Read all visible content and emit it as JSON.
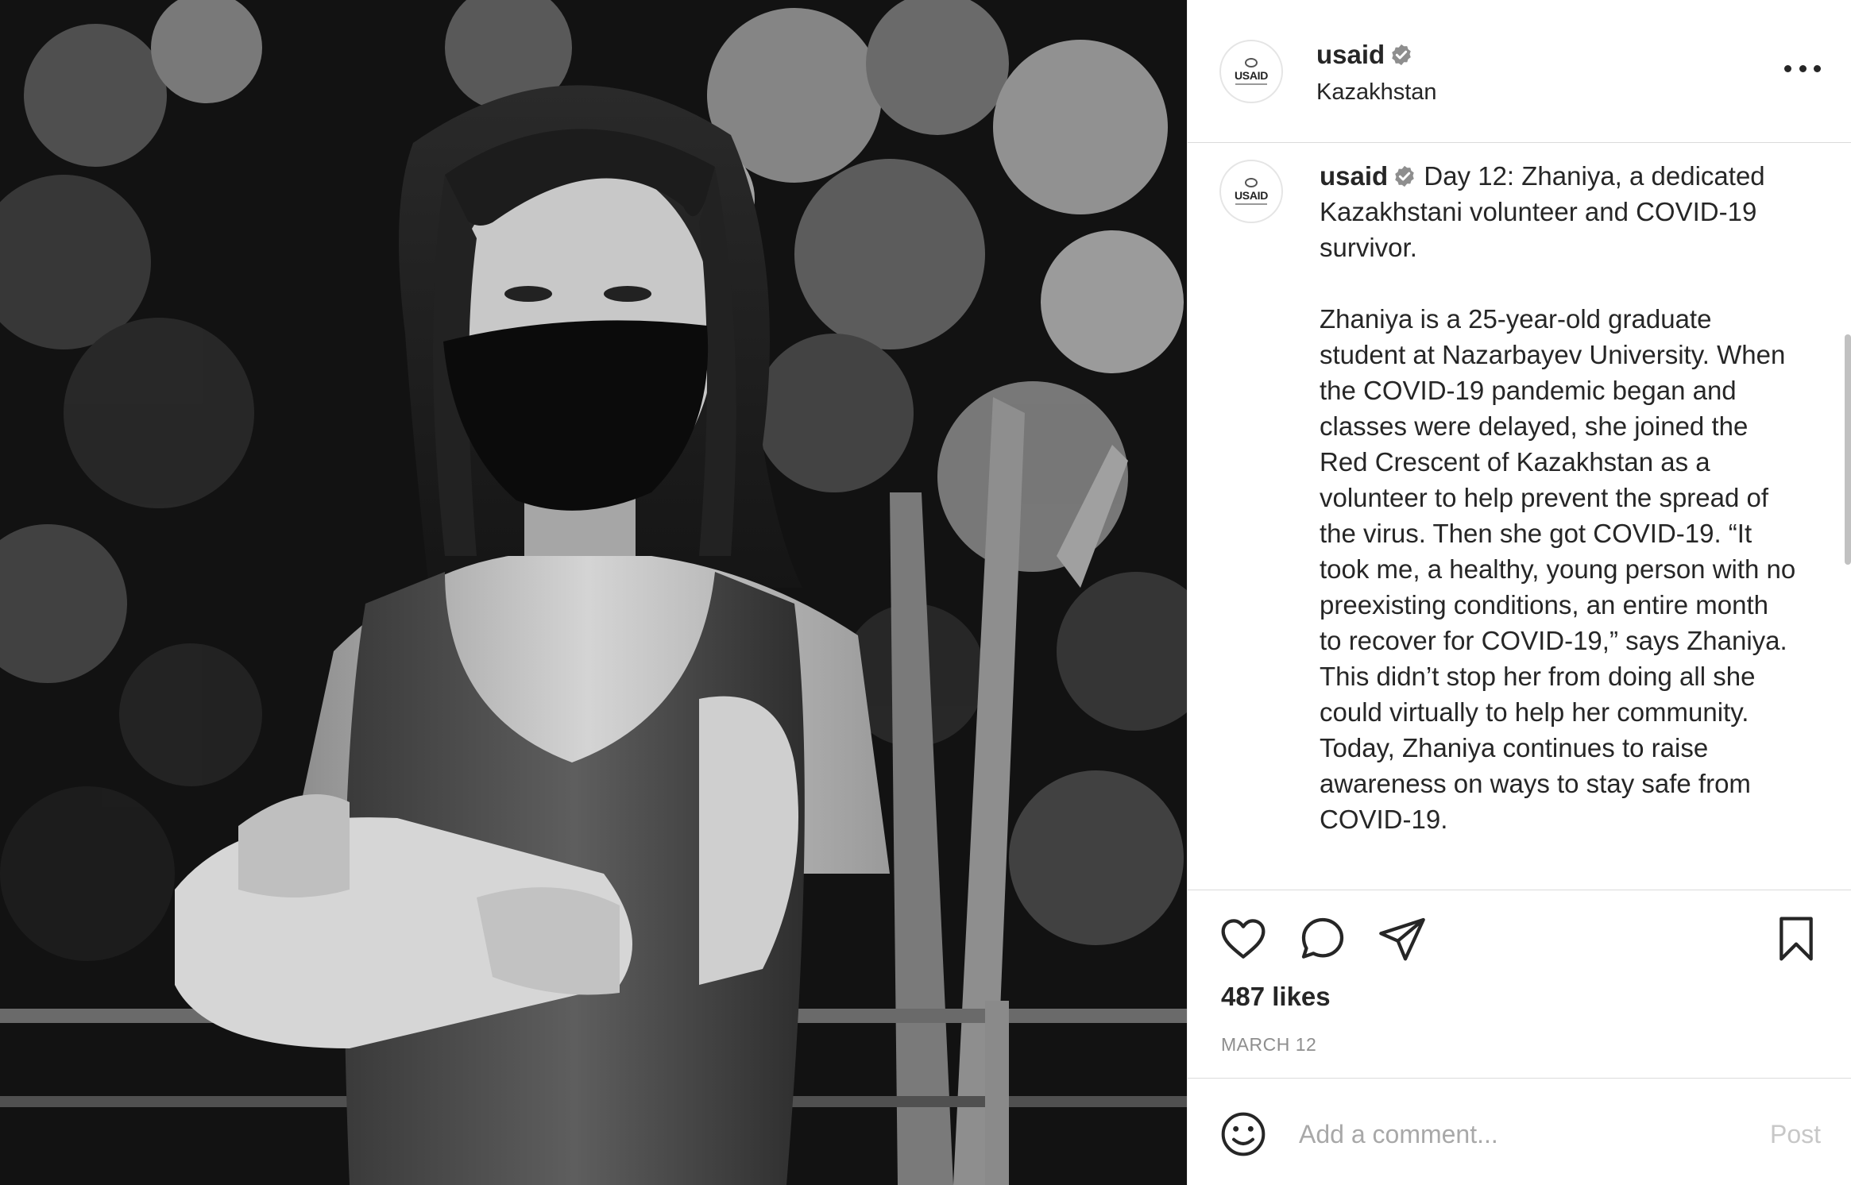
{
  "post": {
    "username": "usaid",
    "location": "Kazakhstan",
    "avatar_text": "USAID",
    "verified_icon": "verified-badge-icon",
    "more_icon": "more-options-icon"
  },
  "caption": {
    "username": "usaid",
    "text": "Day 12: Zhaniya, a dedicated Kazakhstani volunteer and COVID-19 survivor.\n\nZhaniya is a 25-year-old graduate student at Nazarbayev University. When the COVID-19 pandemic began and classes were delayed, she joined the Red Crescent of Kazakhstan as a volunteer to help prevent the spread of the virus. Then she got COVID-19. “It took me, a healthy, young person with no preexisting conditions, an entire month to recover for COVID-19,” says Zhaniya. This didn’t stop her from doing all she could virtually to help her community. Today, Zhaniya continues to raise awareness on ways to stay safe from COVID-19."
  },
  "actions": {
    "like_icon": "heart-icon",
    "comment_icon": "comment-bubble-icon",
    "share_icon": "paper-plane-icon",
    "save_icon": "bookmark-icon"
  },
  "likes": "487 likes",
  "date": "MARCH 12",
  "comment": {
    "placeholder": "Add a comment...",
    "post_label": "Post",
    "emoji_icon": "smiley-icon"
  },
  "colors": {
    "text": "#262626",
    "secondary": "#8e8e8e",
    "border": "#dbdbdb",
    "post_disabled": "#c7c7c7"
  }
}
